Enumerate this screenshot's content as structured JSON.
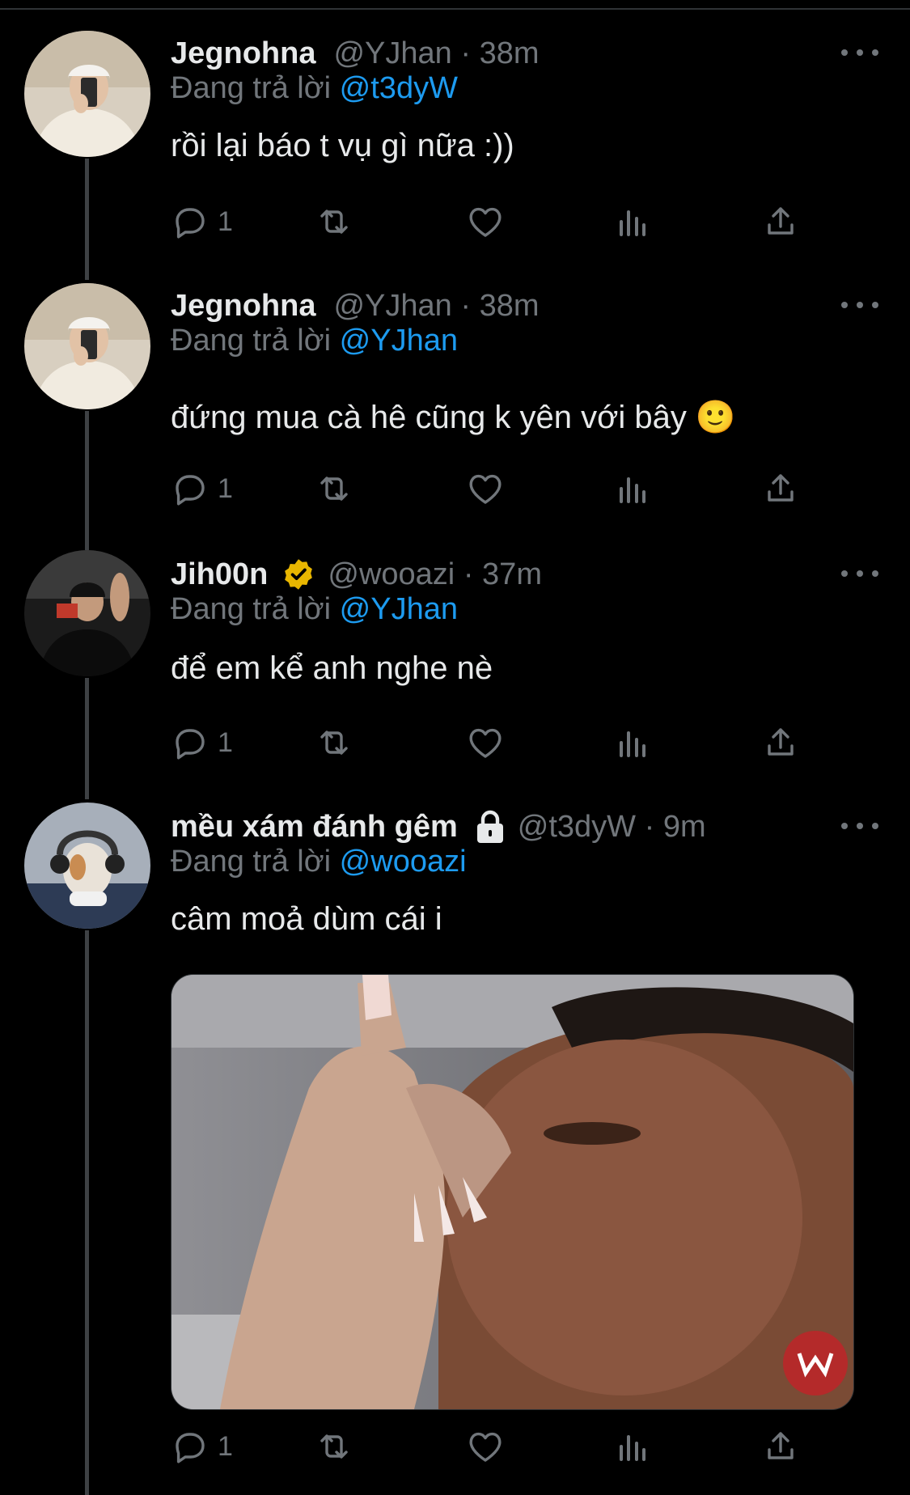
{
  "tweets": [
    {
      "name": "Jegnohna",
      "handle": "@YJhan",
      "sep": " · ",
      "time": "38m",
      "reply_prefix": "Đang trả lời",
      "reply_to": "@t3dyW",
      "text": "rồi lại báo t vụ gì nữa :))",
      "reply_count": "1"
    },
    {
      "name": "Jegnohna",
      "handle": "@YJhan",
      "sep": " · ",
      "time": "38m",
      "reply_prefix": "Đang trả lời",
      "reply_to": "@YJhan",
      "text": "đứng mua cà hê cũng k yên với bây 🙂",
      "reply_count": "1"
    },
    {
      "name": "Jih00n",
      "verified": true,
      "handle": "@wooazi",
      "sep": " · ",
      "time": "37m",
      "reply_prefix": "Đang trả lời",
      "reply_to": "@YJhan",
      "text": "để em kể anh nghe nè",
      "reply_count": "1"
    },
    {
      "name": "mều xám đánh gêm",
      "protected": true,
      "handle": "@t3dyW",
      "sep": " · ",
      "time": "9m",
      "reply_prefix": "Đang trả lời",
      "reply_to": "@wooazi",
      "text": "câm moả dùm cái i",
      "has_media": true,
      "reply_count": "1"
    }
  ],
  "icons": {
    "reply": "reply-icon",
    "retweet": "retweet-icon",
    "like": "heart-icon",
    "views": "analytics-icon",
    "share": "share-icon",
    "more": "more-icon",
    "verified": "verified-badge-icon",
    "protected": "lock-icon"
  },
  "colors": {
    "background": "#000000",
    "text": "#e7e9ea",
    "muted": "#71767b",
    "link": "#1d9bf0",
    "verified": "#e8b600",
    "thread_line": "#3e4144"
  }
}
